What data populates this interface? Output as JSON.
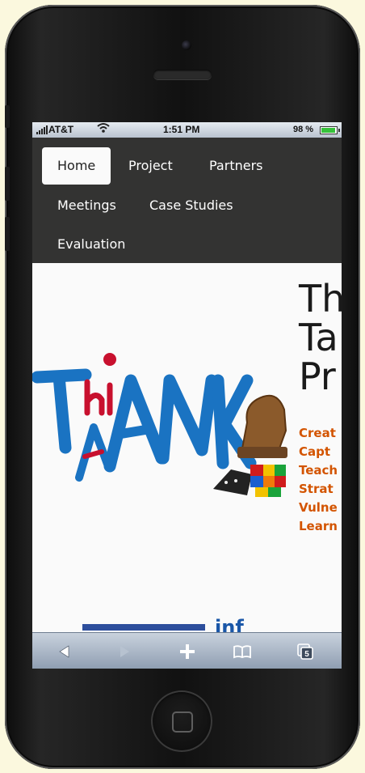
{
  "status_bar": {
    "carrier": "AT&T",
    "time": "1:51 PM",
    "battery": "98 %",
    "battery_level": 0.98
  },
  "nav": {
    "items": [
      {
        "label": "Home",
        "active": true
      },
      {
        "label": "Project",
        "active": false
      },
      {
        "label": "Partners",
        "active": false
      },
      {
        "label": "Meetings",
        "active": false
      },
      {
        "label": "Case Studies",
        "active": false
      },
      {
        "label": "Evaluation",
        "active": false
      }
    ]
  },
  "logo": {
    "letters": [
      "T",
      "hi",
      "A",
      "N",
      "K"
    ],
    "colors": {
      "blue": "#1a73c2",
      "red": "#c8102e"
    }
  },
  "hero": {
    "title_lines": [
      "Th",
      "Ta",
      "Pr"
    ],
    "list": [
      "Creat",
      "Capt",
      "Teach",
      "Strat",
      "Vulne",
      "Learn"
    ]
  },
  "footer_peek": {
    "text": "inf"
  },
  "toolbar": {
    "icons": [
      "back-icon",
      "forward-icon",
      "add-icon",
      "bookmarks-icon",
      "tabs-icon"
    ],
    "tabs_count": "5"
  },
  "colors": {
    "accent_orange": "#d35400",
    "nav_bg": "#333332"
  }
}
